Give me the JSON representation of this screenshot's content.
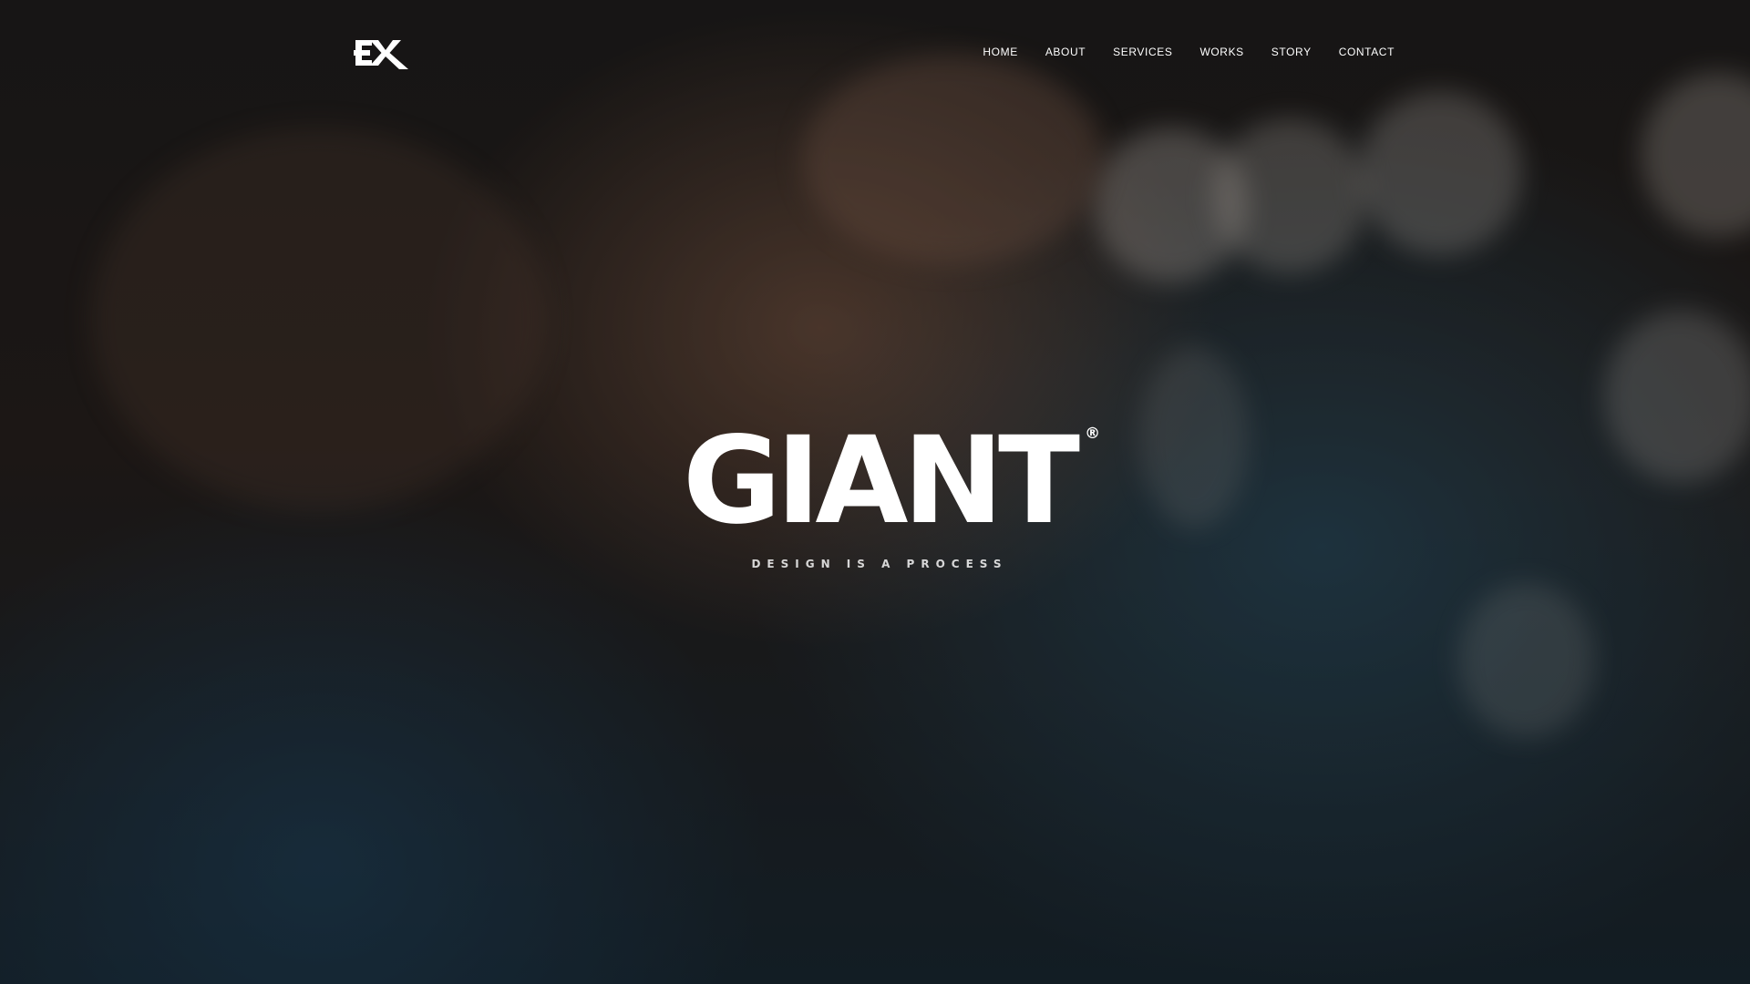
{
  "brand": {
    "logo_text": "EX",
    "title": "GIANT",
    "registered_mark": "®",
    "tagline": "DESIGN IS A PROCESS"
  },
  "nav": {
    "items": [
      {
        "label": "HOME"
      },
      {
        "label": "ABOUT"
      },
      {
        "label": "SERVICES"
      },
      {
        "label": "WORKS"
      },
      {
        "label": "STORY"
      },
      {
        "label": "CONTACT"
      }
    ]
  },
  "colors": {
    "text": "#ffffff",
    "overlay": "#0a0a0c",
    "bokeh": "#d9d2c8"
  },
  "icons": {
    "logo": "ex-logo-icon"
  }
}
